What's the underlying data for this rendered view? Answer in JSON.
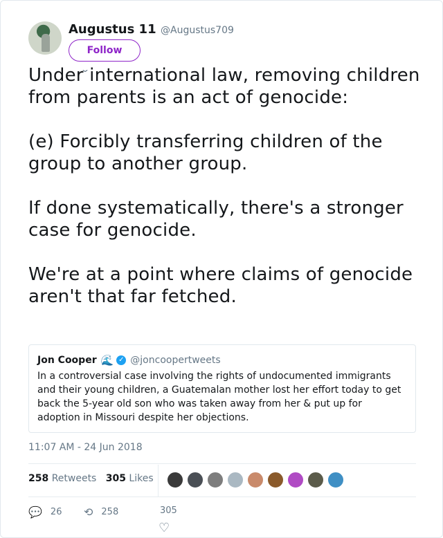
{
  "author": {
    "name": "Augustus 11",
    "handle": "@Augustus709",
    "follow_label": "Follow",
    "caret": "⌄"
  },
  "tweet": {
    "text": "Under international law, removing children from parents is an act of genocide:\n\n(e) Forcibly transferring children of the group to another group.\n\nIf done systematically, there's a stronger case for genocide.\n\nWe're at a point where claims of genocide aren't that far fetched.",
    "timestamp": "11:07 AM - 24 Jun 2018"
  },
  "quoted": {
    "name": "Jon Cooper",
    "emoji": "🌊",
    "verified": "✓",
    "handle": "@joncoopertweets",
    "text": "In a controversial case involving the rights of undocumented immigrants and their young children, a Guatemalan mother lost her effort today to get back the 5-year old son who was taken away from her & put up for adoption in Missouri despite her objections."
  },
  "stats": {
    "retweets_count": "258",
    "retweets_label": "Retweets",
    "likes_count": "305",
    "likes_label": "Likes"
  },
  "likers": [
    "#3a3a3a",
    "#4a4f55",
    "#7d7d7d",
    "#aab8c2",
    "#c98a6b",
    "#8a5a2b",
    "#b04bc4",
    "#5b5b4a",
    "#3f8fc4"
  ],
  "actions": {
    "reply_icon": "💬",
    "reply_count": "26",
    "retweet_icon": "⟲",
    "retweet_count": "258",
    "like_count": "305",
    "like_icon": "♡"
  }
}
